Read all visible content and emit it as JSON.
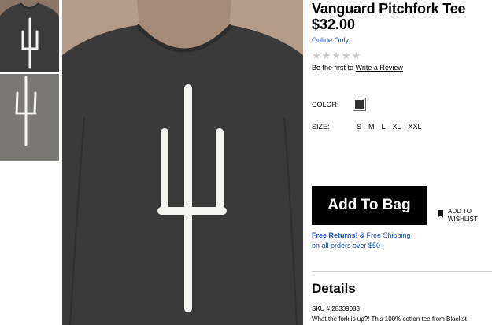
{
  "product": {
    "title": "Vanguard Pitchfork Tee",
    "price": "$32.00",
    "availability": "Online Only",
    "rating": 0,
    "review_prompt": "Be the first to ",
    "review_link": "Write a Review"
  },
  "options": {
    "color_label": "COLOR:",
    "color_value": "#333333",
    "size_label": "SIZE:",
    "sizes": [
      "S",
      "M",
      "L",
      "XL",
      "XXL"
    ]
  },
  "actions": {
    "add_to_bag": "Add To Bag",
    "wishlist": "ADD TO WISHLIST"
  },
  "promo": {
    "free_returns": "Free Returns!",
    "rest_line1": " & Free Shipping",
    "line2": "on all orders over $50"
  },
  "details": {
    "heading": "Details",
    "sku": "SKU # 28339083",
    "description": "What the fork is up?! This 100% cotton tee from Blackst"
  },
  "colors": {
    "link_blue": "#1a4fb3",
    "button_bg": "#000000",
    "shirt": "#3a3a3a",
    "skin": "#b49c89"
  }
}
